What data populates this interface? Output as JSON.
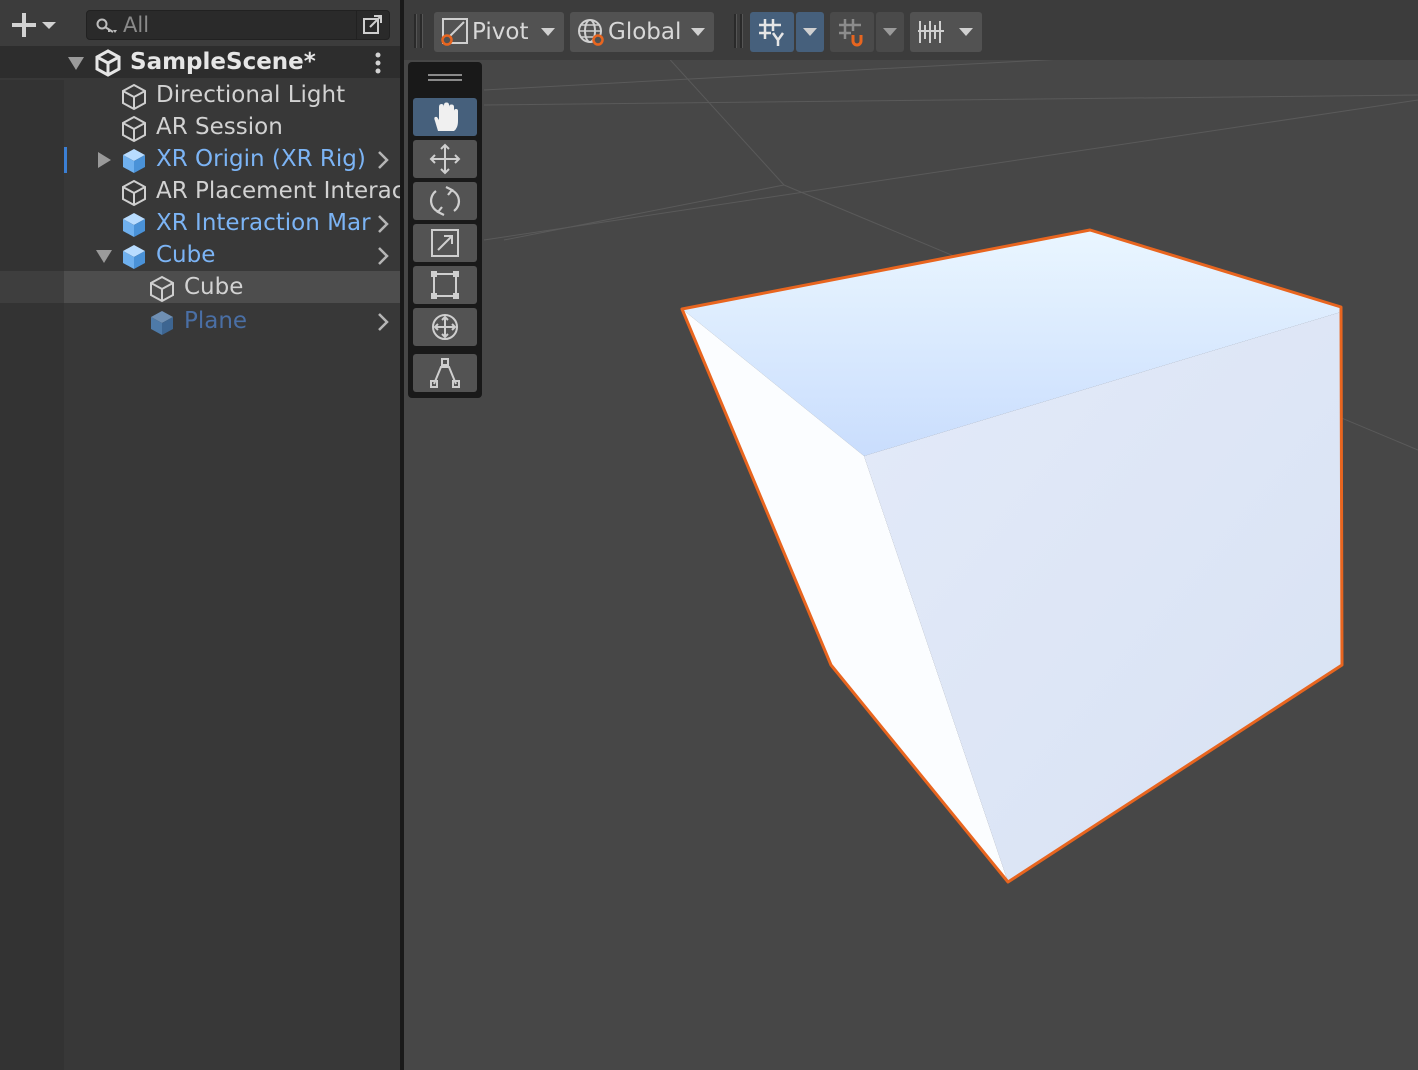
{
  "hierarchy": {
    "search": {
      "placeholder": "All"
    },
    "scene": {
      "name": "SampleScene*"
    },
    "items": [
      {
        "label": "Directional Light"
      },
      {
        "label": "AR Session"
      },
      {
        "label": "XR Origin (XR Rig)"
      },
      {
        "label": "AR Placement Interac"
      },
      {
        "label": "XR Interaction Mar"
      },
      {
        "label": "Cube"
      },
      {
        "label": "Cube"
      },
      {
        "label": "Plane"
      }
    ]
  },
  "scene_toolbar": {
    "pivot_label": "Pivot",
    "global_label": "Global"
  },
  "colors": {
    "selection_outline": "#e8651f",
    "prefab_blue": "#7cb4f5",
    "active_tool": "#46607c"
  },
  "tools": [
    "hand-tool",
    "move-tool",
    "rotate-tool",
    "scale-tool",
    "rect-tool",
    "transform-tool",
    "custom-editor-tool"
  ]
}
